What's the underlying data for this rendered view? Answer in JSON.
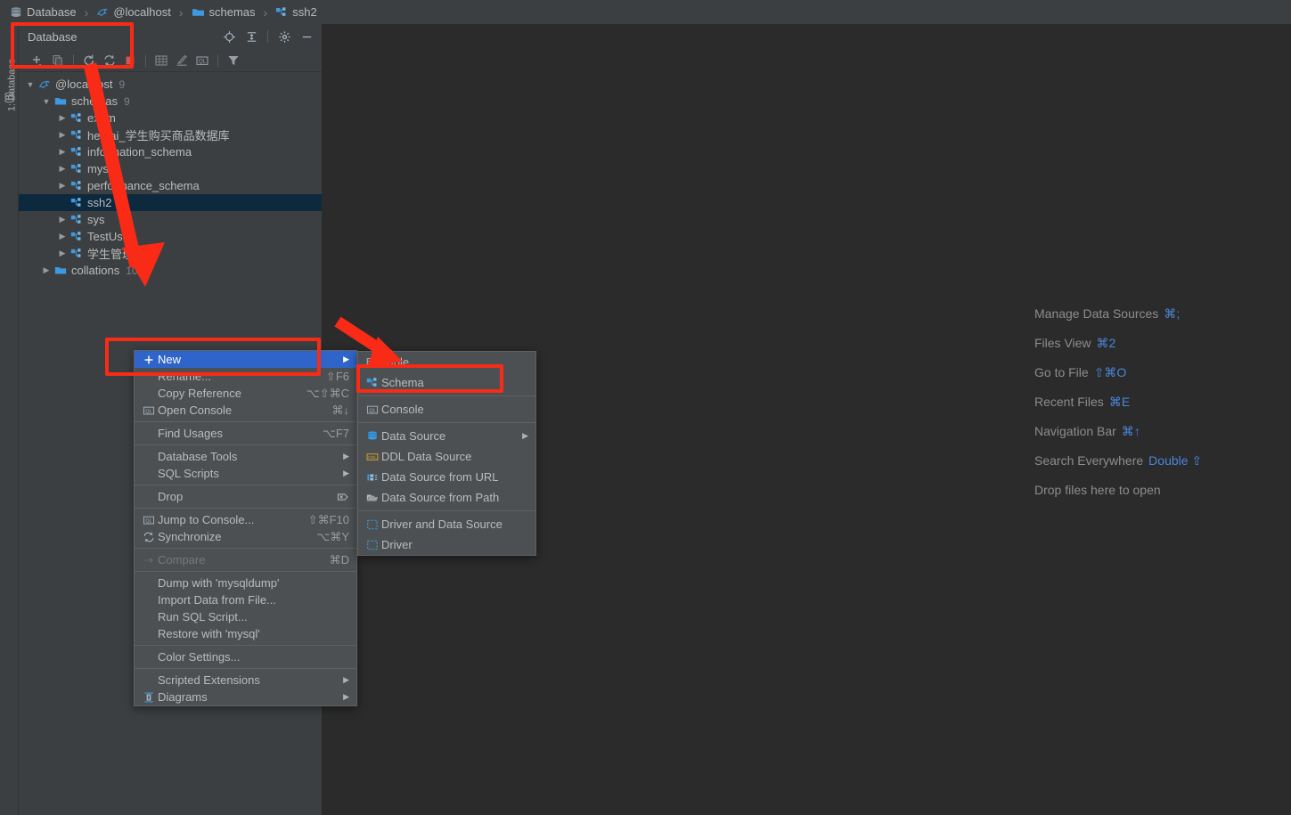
{
  "breadcrumb": {
    "items": [
      {
        "label": "Database",
        "icon": "database-icon"
      },
      {
        "label": "@localhost",
        "icon": "mysql-dolphin-icon"
      },
      {
        "label": "schemas",
        "icon": "folder-icon"
      },
      {
        "label": "ssh2",
        "icon": "schema-icon"
      }
    ],
    "separator": "›"
  },
  "left_stripe": {
    "tab_label": "1: Database",
    "tab_icon": "database-stripe-icon"
  },
  "tool_window": {
    "title": "Database",
    "header_icons": [
      {
        "name": "locate-icon"
      },
      {
        "name": "collapse-all-icon"
      },
      {
        "name": "settings-gear-icon"
      },
      {
        "name": "hide-minimize-icon"
      }
    ],
    "toolbar_icons": [
      {
        "name": "add-new-icon"
      },
      {
        "name": "duplicate-icon"
      },
      {
        "name": "refresh-icon"
      },
      {
        "name": "synchronize-icon"
      },
      {
        "name": "stop-icon"
      },
      {
        "name": "table-editor-icon"
      },
      {
        "name": "modify-icon"
      },
      {
        "name": "query-console-icon"
      },
      {
        "name": "filter-icon"
      }
    ]
  },
  "tree": {
    "rows": [
      {
        "label": "@localhost",
        "count": "9",
        "indent": 0,
        "arrow": "expanded",
        "icon": "mysql-dolphin-icon",
        "selected": false
      },
      {
        "label": "schemas",
        "count": "9",
        "indent": 1,
        "arrow": "expanded",
        "icon": "folder-icon",
        "selected": false
      },
      {
        "label": "exam",
        "count": "",
        "indent": 2,
        "arrow": "collapsed",
        "icon": "schema-icon",
        "selected": false
      },
      {
        "label": "hemai_学生购买商品数据库",
        "count": "",
        "indent": 2,
        "arrow": "collapsed",
        "icon": "schema-icon",
        "selected": false
      },
      {
        "label": "information_schema",
        "count": "",
        "indent": 2,
        "arrow": "collapsed",
        "icon": "schema-icon",
        "selected": false
      },
      {
        "label": "mysql",
        "count": "",
        "indent": 2,
        "arrow": "collapsed",
        "icon": "schema-icon",
        "selected": false
      },
      {
        "label": "performance_schema",
        "count": "",
        "indent": 2,
        "arrow": "collapsed",
        "icon": "schema-icon",
        "selected": false
      },
      {
        "label": "ssh2",
        "count": "",
        "indent": 2,
        "arrow": "none",
        "icon": "schema-icon",
        "selected": true
      },
      {
        "label": "sys",
        "count": "",
        "indent": 2,
        "arrow": "collapsed",
        "icon": "schema-icon",
        "selected": false
      },
      {
        "label": "TestUser",
        "count": "",
        "indent": 2,
        "arrow": "collapsed",
        "icon": "schema-icon",
        "selected": false
      },
      {
        "label": "学生管理系统",
        "count": "",
        "indent": 2,
        "arrow": "collapsed",
        "icon": "schema-icon",
        "selected": false
      },
      {
        "label": "collations",
        "count": "10",
        "indent": 1,
        "arrow": "collapsed",
        "icon": "folder-icon",
        "selected": false
      }
    ]
  },
  "context_menu": {
    "items": [
      {
        "type": "item",
        "label": "New",
        "shortcut": "",
        "icon": "plus-icon",
        "submenu": true,
        "highlight": true,
        "disabled": false
      },
      {
        "type": "item",
        "label": "Rename...",
        "shortcut": "⇧F6",
        "icon": "",
        "submenu": false,
        "highlight": false,
        "disabled": false
      },
      {
        "type": "item",
        "label": "Copy Reference",
        "shortcut": "⌥⇧⌘C",
        "icon": "",
        "submenu": false,
        "highlight": false,
        "disabled": false
      },
      {
        "type": "item",
        "label": "Open Console",
        "shortcut": "⌘↓",
        "icon": "query-console-icon",
        "submenu": false,
        "highlight": false,
        "disabled": false
      },
      {
        "type": "separator"
      },
      {
        "type": "item",
        "label": "Find Usages",
        "shortcut": "⌥F7",
        "icon": "",
        "submenu": false,
        "highlight": false,
        "disabled": false
      },
      {
        "type": "separator"
      },
      {
        "type": "item",
        "label": "Database Tools",
        "shortcut": "",
        "icon": "",
        "submenu": true,
        "highlight": false,
        "disabled": false
      },
      {
        "type": "item",
        "label": "SQL Scripts",
        "shortcut": "",
        "icon": "",
        "submenu": true,
        "highlight": false,
        "disabled": false
      },
      {
        "type": "separator"
      },
      {
        "type": "item",
        "label": "Drop",
        "shortcut": "",
        "icon": "",
        "submenu": false,
        "highlight": false,
        "disabled": false,
        "trailing_icon": "drop-tag-icon"
      },
      {
        "type": "separator"
      },
      {
        "type": "item",
        "label": "Jump to Console...",
        "shortcut": "⇧⌘F10",
        "icon": "query-console-icon",
        "submenu": false,
        "highlight": false,
        "disabled": false
      },
      {
        "type": "item",
        "label": "Synchronize",
        "shortcut": "⌥⌘Y",
        "icon": "synchronize-icon",
        "submenu": false,
        "highlight": false,
        "disabled": false
      },
      {
        "type": "separator"
      },
      {
        "type": "item",
        "label": "Compare",
        "shortcut": "⌘D",
        "icon": "compare-icon",
        "submenu": false,
        "highlight": false,
        "disabled": true
      },
      {
        "type": "separator"
      },
      {
        "type": "item",
        "label": "Dump with 'mysqldump'",
        "shortcut": "",
        "icon": "",
        "submenu": false,
        "highlight": false,
        "disabled": false
      },
      {
        "type": "item",
        "label": "Import Data from File...",
        "shortcut": "",
        "icon": "",
        "submenu": false,
        "highlight": false,
        "disabled": false
      },
      {
        "type": "item",
        "label": "Run SQL Script...",
        "shortcut": "",
        "icon": "",
        "submenu": false,
        "highlight": false,
        "disabled": false
      },
      {
        "type": "item",
        "label": "Restore with 'mysql'",
        "shortcut": "",
        "icon": "",
        "submenu": false,
        "highlight": false,
        "disabled": false
      },
      {
        "type": "separator"
      },
      {
        "type": "item",
        "label": "Color Settings...",
        "shortcut": "",
        "icon": "",
        "submenu": false,
        "highlight": false,
        "disabled": false
      },
      {
        "type": "separator"
      },
      {
        "type": "item",
        "label": "Scripted Extensions",
        "shortcut": "",
        "icon": "",
        "submenu": true,
        "highlight": false,
        "disabled": false
      },
      {
        "type": "item",
        "label": "Diagrams",
        "shortcut": "",
        "icon": "diagram-icon",
        "submenu": true,
        "highlight": false,
        "disabled": false
      }
    ]
  },
  "submenu": {
    "items": [
      {
        "type": "item",
        "label": "Table",
        "icon": "table-icon",
        "submenu": false
      },
      {
        "type": "item",
        "label": "Schema",
        "icon": "schema-icon",
        "submenu": false,
        "annotated": true
      },
      {
        "type": "separator"
      },
      {
        "type": "item",
        "label": "Console",
        "icon": "query-console-icon",
        "submenu": false
      },
      {
        "type": "separator"
      },
      {
        "type": "item",
        "label": "Data Source",
        "icon": "datasource-icon",
        "submenu": true
      },
      {
        "type": "item",
        "label": "DDL Data Source",
        "icon": "ddl-icon",
        "submenu": false
      },
      {
        "type": "item",
        "label": "Data Source from URL",
        "icon": "url-icon",
        "submenu": false
      },
      {
        "type": "item",
        "label": "Data Source from Path",
        "icon": "path-folder-icon",
        "submenu": false
      },
      {
        "type": "separator"
      },
      {
        "type": "item",
        "label": "Driver and Data Source",
        "icon": "driver-icon",
        "submenu": false
      },
      {
        "type": "item",
        "label": "Driver",
        "icon": "driver-icon",
        "submenu": false
      }
    ]
  },
  "hints": [
    {
      "label": "Manage Data Sources",
      "key": "⌘;"
    },
    {
      "label": "Files View",
      "key": "⌘2"
    },
    {
      "label": "Go to File",
      "key": "⇧⌘O"
    },
    {
      "label": "Recent Files",
      "key": "⌘E"
    },
    {
      "label": "Navigation Bar",
      "key": "⌘↑"
    },
    {
      "label": "Search Everywhere",
      "key": "Double ⇧"
    },
    {
      "label": "Drop files here to open",
      "key": ""
    }
  ],
  "colors": {
    "accent_blue": "#2f65ca",
    "annotation_red": "#f92b16",
    "panel_bg": "#3c3f41",
    "editor_bg": "#2b2b2b",
    "menu_bg": "#4c5052",
    "selection_navy": "#0d293e",
    "link_blue": "#4a86d8"
  }
}
